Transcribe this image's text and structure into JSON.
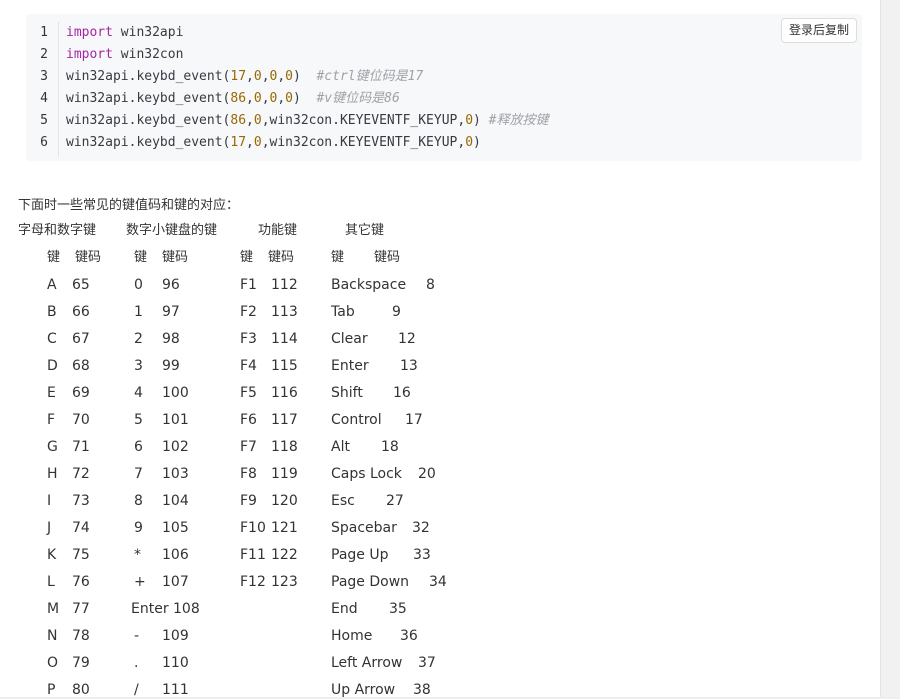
{
  "code": {
    "copy_button": "登录后复制",
    "lines": [
      {
        "n": "1",
        "parts": [
          {
            "k": "kw",
            "t": "import"
          },
          {
            "k": "",
            "t": " win32api"
          }
        ]
      },
      {
        "n": "2",
        "parts": [
          {
            "k": "kw",
            "t": "import"
          },
          {
            "k": "",
            "t": " win32con"
          }
        ]
      },
      {
        "n": "3",
        "parts": [
          {
            "k": "",
            "t": "win32api.keybd_event("
          },
          {
            "k": "num",
            "t": "17"
          },
          {
            "k": "",
            "t": ","
          },
          {
            "k": "num",
            "t": "0"
          },
          {
            "k": "",
            "t": ","
          },
          {
            "k": "num",
            "t": "0"
          },
          {
            "k": "",
            "t": ","
          },
          {
            "k": "num",
            "t": "0"
          },
          {
            "k": "",
            "t": ")  "
          },
          {
            "k": "cm",
            "t": "#ctrl键位码是17"
          }
        ]
      },
      {
        "n": "4",
        "parts": [
          {
            "k": "",
            "t": "win32api.keybd_event("
          },
          {
            "k": "num",
            "t": "86"
          },
          {
            "k": "",
            "t": ","
          },
          {
            "k": "num",
            "t": "0"
          },
          {
            "k": "",
            "t": ","
          },
          {
            "k": "num",
            "t": "0"
          },
          {
            "k": "",
            "t": ","
          },
          {
            "k": "num",
            "t": "0"
          },
          {
            "k": "",
            "t": ")  "
          },
          {
            "k": "cm",
            "t": "#v键位码是86"
          }
        ]
      },
      {
        "n": "5",
        "parts": [
          {
            "k": "",
            "t": "win32api.keybd_event("
          },
          {
            "k": "num",
            "t": "86"
          },
          {
            "k": "",
            "t": ","
          },
          {
            "k": "num",
            "t": "0"
          },
          {
            "k": "",
            "t": ",win32con.KEYEVENTF_KEYUP,"
          },
          {
            "k": "num",
            "t": "0"
          },
          {
            "k": "",
            "t": ") "
          },
          {
            "k": "cm",
            "t": "#释放按键"
          }
        ]
      },
      {
        "n": "6",
        "parts": [
          {
            "k": "",
            "t": "win32api.keybd_event("
          },
          {
            "k": "num",
            "t": "17"
          },
          {
            "k": "",
            "t": ","
          },
          {
            "k": "num",
            "t": "0"
          },
          {
            "k": "",
            "t": ",win32con.KEYEVENTF_KEYUP,"
          },
          {
            "k": "num",
            "t": "0"
          },
          {
            "k": "",
            "t": ")"
          }
        ]
      }
    ]
  },
  "intro": "下面时一些常见的键值码和键的对应：",
  "group_headers": [
    "字母和数字键",
    "数字小键盘的键",
    "功能键",
    "其它键"
  ],
  "col_headers": {
    "g1": [
      "键",
      "键码"
    ],
    "g2": [
      "键",
      "键码"
    ],
    "g3": [
      "键",
      "键码"
    ],
    "g4": [
      "键",
      "键码"
    ]
  },
  "letters": [
    [
      "A",
      "65"
    ],
    [
      "B",
      "66"
    ],
    [
      "C",
      "67"
    ],
    [
      "D",
      "68"
    ],
    [
      "E",
      "69"
    ],
    [
      "F",
      "70"
    ],
    [
      "G",
      "71"
    ],
    [
      "H",
      "72"
    ],
    [
      "I",
      "73"
    ],
    [
      "J",
      "74"
    ],
    [
      "K",
      "75"
    ],
    [
      "L",
      "76"
    ],
    [
      "M",
      "77"
    ],
    [
      "N",
      "78"
    ],
    [
      "O",
      "79"
    ],
    [
      "P",
      "80"
    ]
  ],
  "numpad": [
    [
      "0",
      "96"
    ],
    [
      "1",
      "97"
    ],
    [
      "2",
      "98"
    ],
    [
      "3",
      "99"
    ],
    [
      "4",
      "100"
    ],
    [
      "5",
      "101"
    ],
    [
      "6",
      "102"
    ],
    [
      "7",
      "103"
    ],
    [
      "8",
      "104"
    ],
    [
      "9",
      "105"
    ],
    [
      "*",
      "106"
    ],
    [
      "+",
      "107"
    ],
    [
      "Enter",
      "108"
    ],
    [
      "-",
      "109"
    ],
    [
      ".",
      "110"
    ],
    [
      "/",
      "111"
    ]
  ],
  "function_keys": [
    [
      "F1",
      "112"
    ],
    [
      "F2",
      "113"
    ],
    [
      "F3",
      "114"
    ],
    [
      "F4",
      "115"
    ],
    [
      "F5",
      "116"
    ],
    [
      "F6",
      "117"
    ],
    [
      "F7",
      "118"
    ],
    [
      "F8",
      "119"
    ],
    [
      "F9",
      "120"
    ],
    [
      "F10",
      "121"
    ],
    [
      "F11",
      "122"
    ],
    [
      "F12",
      "123"
    ]
  ],
  "other_keys": [
    [
      "Backspace",
      "8"
    ],
    [
      "Tab",
      "9"
    ],
    [
      "Clear",
      "12"
    ],
    [
      "Enter",
      "13"
    ],
    [
      "Shift",
      "16"
    ],
    [
      "Control",
      "17"
    ],
    [
      "Alt",
      "18"
    ],
    [
      "Caps Lock",
      "20"
    ],
    [
      "Esc",
      "27"
    ],
    [
      "Spacebar",
      "32"
    ],
    [
      "Page Up",
      "33"
    ],
    [
      "Page Down",
      "34"
    ],
    [
      "End",
      "35"
    ],
    [
      "Home",
      "36"
    ],
    [
      "Left Arrow",
      "37"
    ],
    [
      "Up Arrow",
      "38"
    ]
  ]
}
